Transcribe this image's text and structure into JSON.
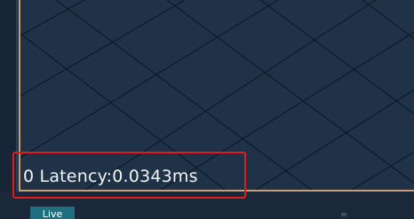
{
  "status": {
    "latency_text": "0 Latency:0.0343ms"
  },
  "bottom_tabs": {
    "live_label": "Live"
  },
  "colors": {
    "viewport_background": "#1f3248",
    "grid_lines": "#0c1622",
    "viewport_border": "#c79f78",
    "highlight_border": "#e21c1c",
    "live_tab": "#1f6f80"
  }
}
